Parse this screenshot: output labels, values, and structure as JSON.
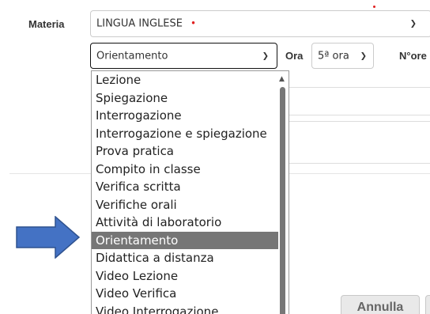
{
  "form": {
    "materia_label": "Materia",
    "materia_value": "LINGUA INGLESE",
    "materia_required_mark": "•",
    "tipo_value": "Orientamento",
    "ora_label": "Ora",
    "ora_value": "5ª ora",
    "nore_label": "N°ore"
  },
  "dropdown": {
    "options": [
      "Lezione",
      "Spiegazione",
      "Interrogazione",
      "Interrogazione e spiegazione",
      "Prova pratica",
      "Compito in classe",
      "Verifica scritta",
      "Verifiche orali",
      "Attività di laboratorio",
      "Orientamento",
      "Didattica a distanza",
      "Video Lezione",
      "Video Verifica",
      "Video Interrogazione"
    ],
    "selected": "Orientamento"
  },
  "buttons": {
    "annulla_label": "Annulla"
  },
  "colors": {
    "selected_bg": "#767676",
    "arrow_fill": "#4472c4",
    "arrow_stroke": "#2f528f",
    "required_mark": "#e02020"
  },
  "icons": {
    "select_chevron": "chevron-down-icon",
    "scroll_up": "scroll-up-arrow-icon",
    "resize": "resize-handle-icon",
    "pointer_arrow": "blue-right-arrow-icon"
  }
}
